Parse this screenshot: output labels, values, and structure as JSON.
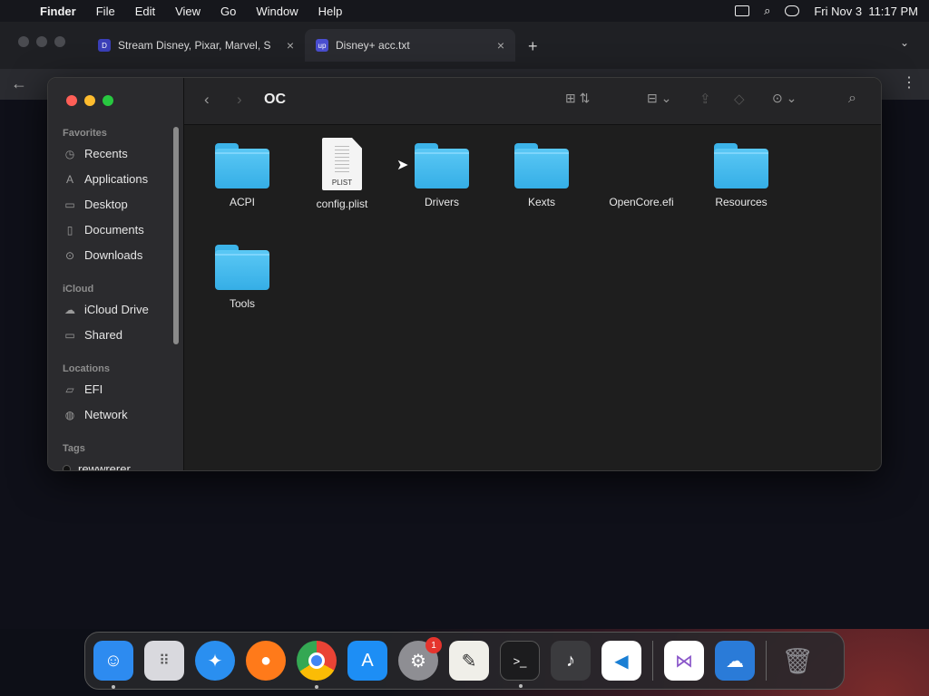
{
  "menubar": {
    "app_name": "Finder",
    "items": [
      "File",
      "Edit",
      "View",
      "Go",
      "Window",
      "Help"
    ],
    "clock": "Fri Nov 3  11:17 PM"
  },
  "browser": {
    "tabs": [
      {
        "title": "Stream Disney, Pixar, Marvel, S",
        "favicon": "D"
      },
      {
        "title": "Disney+ acc.txt",
        "favicon": "up"
      }
    ],
    "new_tab": "+",
    "close": "×"
  },
  "finder": {
    "title": "OC",
    "sidebar": {
      "favorites_heading": "Favorites",
      "favorites": [
        {
          "label": "Recents",
          "icon": "clock-icon"
        },
        {
          "label": "Applications",
          "icon": "applications-icon"
        },
        {
          "label": "Desktop",
          "icon": "desktop-icon"
        },
        {
          "label": "Documents",
          "icon": "document-icon"
        },
        {
          "label": "Downloads",
          "icon": "download-icon"
        }
      ],
      "icloud_heading": "iCloud",
      "icloud": [
        {
          "label": "iCloud Drive",
          "icon": "cloud-icon"
        },
        {
          "label": "Shared",
          "icon": "shared-folder-icon"
        }
      ],
      "locations_heading": "Locations",
      "locations": [
        {
          "label": "EFI",
          "icon": "drive-icon"
        },
        {
          "label": "Network",
          "icon": "globe-icon"
        }
      ],
      "tags_heading": "Tags",
      "tags": [
        {
          "label": "rewwrerer"
        }
      ]
    },
    "items": [
      {
        "name": "ACPI",
        "kind": "folder"
      },
      {
        "name": "config.plist",
        "kind": "plist"
      },
      {
        "name": "Drivers",
        "kind": "folder"
      },
      {
        "name": "Kexts",
        "kind": "folder"
      },
      {
        "name": "OpenCore.efi",
        "kind": "file"
      },
      {
        "name": "Resources",
        "kind": "folder"
      },
      {
        "name": "Tools",
        "kind": "folder"
      }
    ],
    "plist_ext": "PLIST"
  },
  "dock": {
    "apps": [
      {
        "name": "Finder",
        "color": "#2d8bf0"
      },
      {
        "name": "Launchpad",
        "color": "#d9d9de"
      },
      {
        "name": "Safari",
        "color": "#2a8ff0"
      },
      {
        "name": "Firefox",
        "color": "#ff7a1a"
      },
      {
        "name": "Chrome",
        "color": "#f2f2f2"
      },
      {
        "name": "App Store",
        "color": "#1d8ef5"
      },
      {
        "name": "System Settings",
        "color": "#8e8e93",
        "badge": "1"
      },
      {
        "name": "TextEdit",
        "color": "#f0efe9"
      },
      {
        "name": "Terminal",
        "color": "#1c1c1e"
      },
      {
        "name": "GarageBand",
        "color": "#3b3b3e"
      },
      {
        "name": "Visual Studio Code",
        "color": "#ffffff"
      },
      {
        "name": "Visual Studio",
        "color": "#ffffff"
      },
      {
        "name": "Weather",
        "color": "#2a7bd8"
      },
      {
        "name": "Trash",
        "color": "#8d8d92"
      }
    ]
  }
}
